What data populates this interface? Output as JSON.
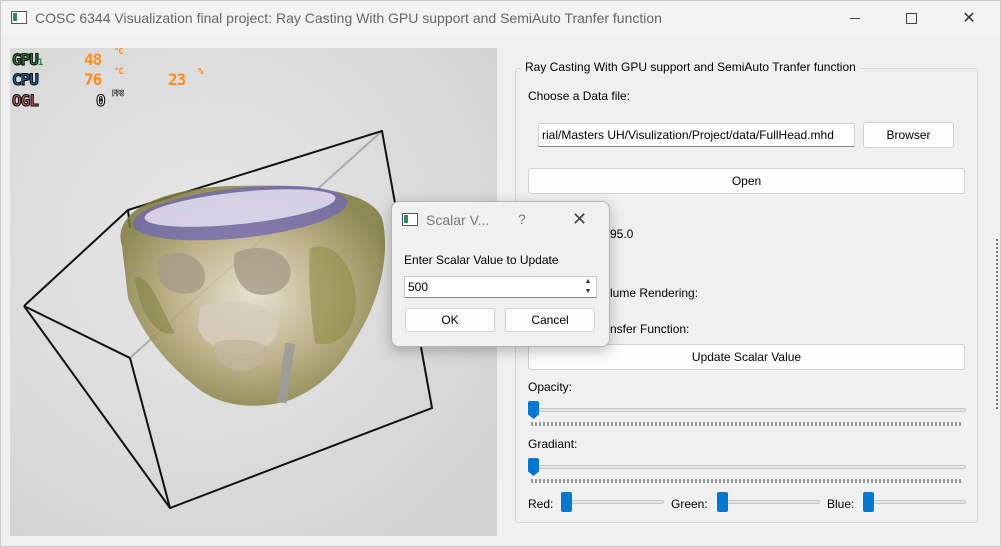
{
  "window": {
    "title": "COSC 6344 Visualization final project: Ray Casting With GPU support and SemiAuto Tranfer function"
  },
  "hud": {
    "gpu_label": "GPU",
    "gpu_sub": "1",
    "gpu_value": "48",
    "gpu_unit": "°C",
    "cpu_label": "CPU",
    "cpu_value": "76",
    "cpu_unit": "°C",
    "cpu_load": "23",
    "cpu_load_unit": "%",
    "ogl_label": "OGL",
    "ogl_value": "0",
    "ogl_unit": "FPS",
    "colors": {
      "gpu": "#1f8a3a",
      "cpu": "#1a6fb0",
      "ogl": "#c06060",
      "value": "#ff8a1a"
    }
  },
  "panel": {
    "group_title": "Ray Casting With GPU support and SemiAuto Tranfer function",
    "choose_label": "Choose a Data file:",
    "file_path": "rial/Masters UH/Visulization/Project/data/FullHead.mhd",
    "browse_button": "Browser",
    "open_button": "Open",
    "partial_value": "95.0",
    "partial_volume_label": "lume Rendering:",
    "partial_transfer_label": "nsfer Function:",
    "update_button": "Update Scalar Value",
    "opacity_label": "Opacity:",
    "gradient_label": "Gradiant:",
    "red_label": "Red:",
    "green_label": "Green:",
    "blue_label": "Blue:"
  },
  "dialog": {
    "title": "Scalar V...",
    "help": "?",
    "prompt": "Enter Scalar Value to Update",
    "value": "500",
    "ok_button": "OK",
    "cancel_button": "Cancel"
  },
  "colors": {
    "accent": "#0078d4"
  }
}
